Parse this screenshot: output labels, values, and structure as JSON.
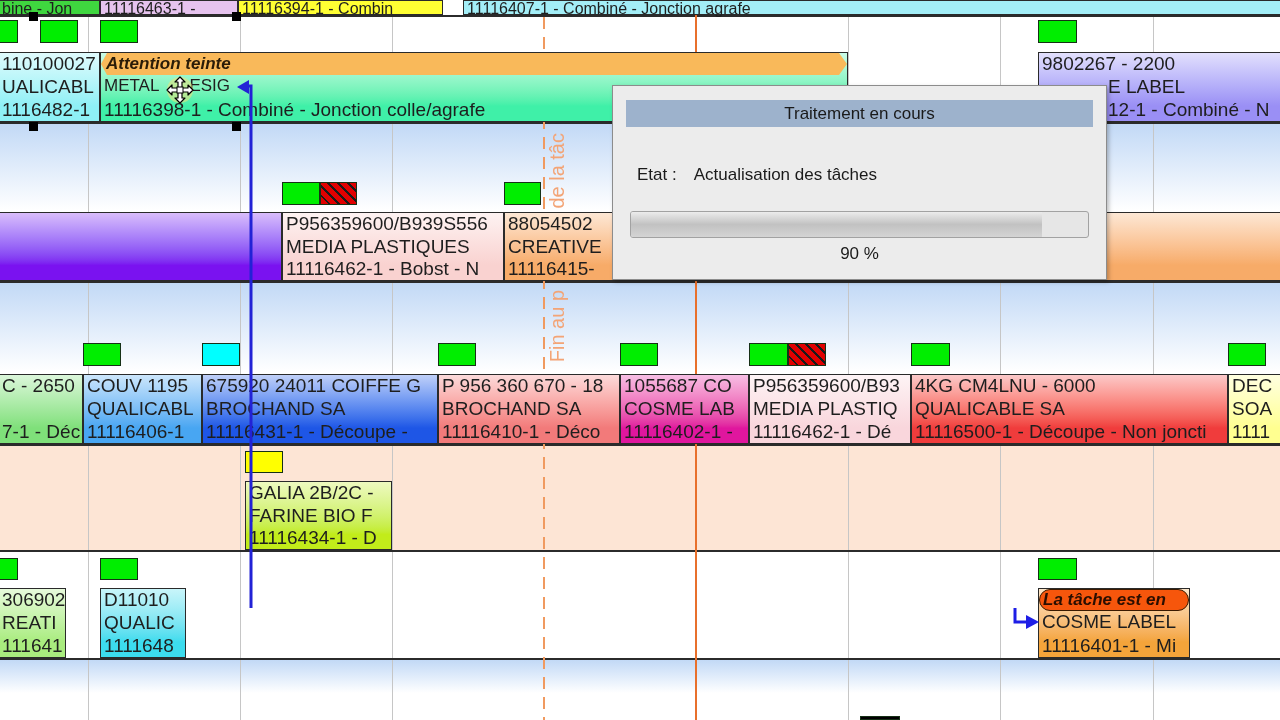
{
  "lanes": [
    {
      "tasks": [
        {
          "color": "#3fd63f",
          "lines": [
            "bine - Jon"
          ]
        },
        {
          "color": "#e6c3ee",
          "lines": [
            "11116463-1 -"
          ]
        },
        {
          "color": "#ffff33",
          "lines": [
            "11116394-1 - Combin"
          ]
        },
        {
          "color": "#a3eef7",
          "lines": [
            "11116407-1 - Combiné - Jonction agrafe"
          ]
        }
      ]
    },
    {
      "markers": [
        {
          "kind": "solid",
          "color": "#00ee00"
        },
        {
          "kind": "solid",
          "color": "#00ee00"
        },
        {
          "kind": "solid",
          "color": "#00ee00"
        },
        {
          "kind": "solid",
          "color": "#00ee00"
        }
      ],
      "tasks": [
        {
          "color": "#8ef0f6",
          "lines": [
            "110100027",
            "UALICABL",
            "1116482-1"
          ]
        },
        {
          "color": "#3ff0a8",
          "alert": {
            "kind": "banner",
            "text": "Attention teinte",
            "color": "#f9b95a"
          },
          "lines": [
            {
              "parts": [
                "METAL",
                "ESIG"
              ]
            },
            "11116398-1 - Combiné - Jonction colle/agrafe"
          ]
        },
        {
          "color": "#9a8ff5",
          "lines": [
            "9802267 - 2200",
            "E LABEL",
            "12-1 - Combiné - N"
          ]
        }
      ]
    },
    {
      "markers": [
        {
          "kind": "solid",
          "color": "#00ee00"
        },
        {
          "kind": "hatched",
          "color": "#e00000"
        },
        {
          "kind": "solid",
          "color": "#00ee00"
        }
      ],
      "tasks": [
        {
          "color": "#7a12f0"
        },
        {
          "color": "#f9d2d0",
          "lines": [
            "P956359600/B939S556",
            "MEDIA PLASTIQUES",
            "11116462-1 - Bobst - N"
          ]
        },
        {
          "color": "#f7ab68",
          "lines": [
            "88054502",
            "CREATIVE",
            "11116415-"
          ]
        }
      ]
    },
    {
      "markers": [
        {
          "kind": "solid",
          "color": "#00ee00"
        },
        {
          "kind": "solid",
          "color": "#00ffff"
        },
        {
          "kind": "solid",
          "color": "#00ee00"
        },
        {
          "kind": "solid",
          "color": "#00ee00"
        },
        {
          "kind": "solid",
          "color": "#00ee00"
        },
        {
          "kind": "hatched",
          "color": "#e00000"
        },
        {
          "kind": "solid",
          "color": "#00ee00"
        },
        {
          "kind": "solid",
          "color": "#00ee00"
        }
      ],
      "tasks": [
        {
          "color": "#7fe07a",
          "lines": [
            "C - 2650",
            "7-1 - Déc"
          ]
        },
        {
          "color": "#48a6f2",
          "lines": [
            "COUV 1195",
            "QUALICABL",
            "11116406-1"
          ]
        },
        {
          "color": "#1e56e6",
          "lines": [
            "675920 24011 COIFFE G",
            "BROCHAND SA",
            "11116431-1 - Découpe -"
          ]
        },
        {
          "color": "#f27a7a",
          "lines": [
            "P 956 360 670 - 18",
            "BROCHAND SA",
            "11116410-1 - Déco"
          ]
        },
        {
          "color": "#e0169e",
          "lines": [
            "1055687 CO",
            "COSME LAB",
            "11116402-1 -"
          ]
        },
        {
          "color": "#f9d6dc",
          "lines": [
            "P956359600/B93",
            "MEDIA PLASTIQ",
            "11116462-1 - Dé"
          ]
        },
        {
          "color": "#f03c3c",
          "lines": [
            "4KG CM4LNU - 6000",
            "QUALICABLE SA",
            "11116500-1 - Découpe - Non joncti"
          ]
        },
        {
          "color": "#ffff90",
          "lines": [
            "DEC",
            "SOA",
            "1111"
          ]
        }
      ]
    },
    {
      "markers": [
        {
          "kind": "solid",
          "color": "#ffff00"
        }
      ],
      "tasks": [
        {
          "color": "#c2ec1a",
          "lines": [
            "GALIA 2B/2C -",
            "FARINE BIO F",
            "11116434-1 - D"
          ]
        }
      ]
    },
    {
      "markers": [
        {
          "kind": "solid",
          "color": "#00ee00"
        },
        {
          "kind": "solid",
          "color": "#00ee00"
        },
        {
          "kind": "solid",
          "color": "#00ee00"
        }
      ],
      "tasks": [
        {
          "color": "#a9ec7e",
          "lines": [
            "306902",
            "REATI",
            "111641"
          ]
        },
        {
          "color": "#3cdcee",
          "lines": [
            "D11010",
            "QUALIC",
            "1111648"
          ]
        },
        {
          "color": "#f4a43a",
          "alert": {
            "kind": "pill",
            "text": "La tâche est en",
            "color": "#f6560c"
          },
          "lines": [
            "COSME LABEL",
            "11116401-1 - Mi"
          ]
        }
      ]
    },
    {
      "markers": [
        {
          "kind": "solid",
          "color": "#000000"
        }
      ]
    }
  ],
  "deadline_line": {
    "label_parts": [
      "de la tâc",
      "Fin au p"
    ]
  },
  "dialog": {
    "title": "Traitement en cours",
    "state_label": "Etat :",
    "state_value": "Actualisation des tâches",
    "progress": {
      "level": 0.9,
      "reading": "90 %"
    }
  }
}
